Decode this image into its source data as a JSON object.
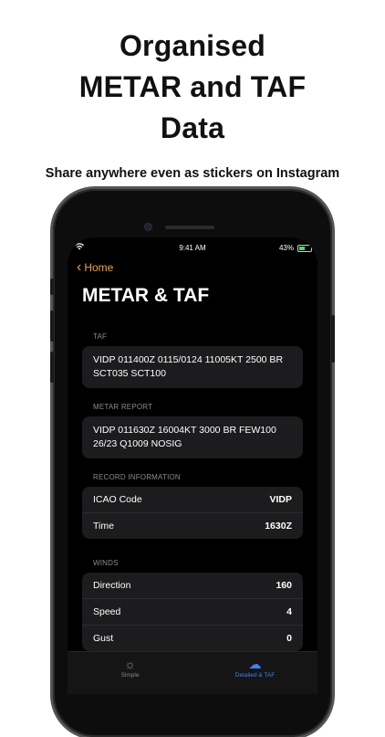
{
  "headline": [
    "Organised",
    "METAR and TAF",
    "Data"
  ],
  "subline": "Share anywhere even as stickers on Instagram",
  "status": {
    "time": "9:41 AM",
    "battery": "43%"
  },
  "nav": {
    "back_label": "Home",
    "title": "METAR & TAF"
  },
  "taf": {
    "label": "TAF",
    "text": "VIDP 011400Z 0115/0124 11005KT 2500 BR SCT035 SCT100"
  },
  "metar": {
    "label": "METAR REPORT",
    "text": "VIDP 011630Z 16004KT 3000 BR FEW100 26/23 Q1009 NOSIG"
  },
  "record": {
    "label": "RECORD INFORMATION",
    "rows": [
      {
        "key": "ICAO Code",
        "value": "VIDP"
      },
      {
        "key": "Time",
        "value": "1630Z"
      }
    ]
  },
  "winds": {
    "label": "WINDS",
    "rows": [
      {
        "key": "Direction",
        "value": "160"
      },
      {
        "key": "Speed",
        "value": "4"
      },
      {
        "key": "Gust",
        "value": "0"
      }
    ]
  },
  "tabs": [
    {
      "label": "Simple",
      "icon": "sun-icon"
    },
    {
      "label": "Detailed & TAF",
      "icon": "cloud-sun-icon"
    }
  ],
  "colors": {
    "accent": "#f2a33a",
    "active_tab": "#3a82f7",
    "card": "#1c1c1e"
  }
}
